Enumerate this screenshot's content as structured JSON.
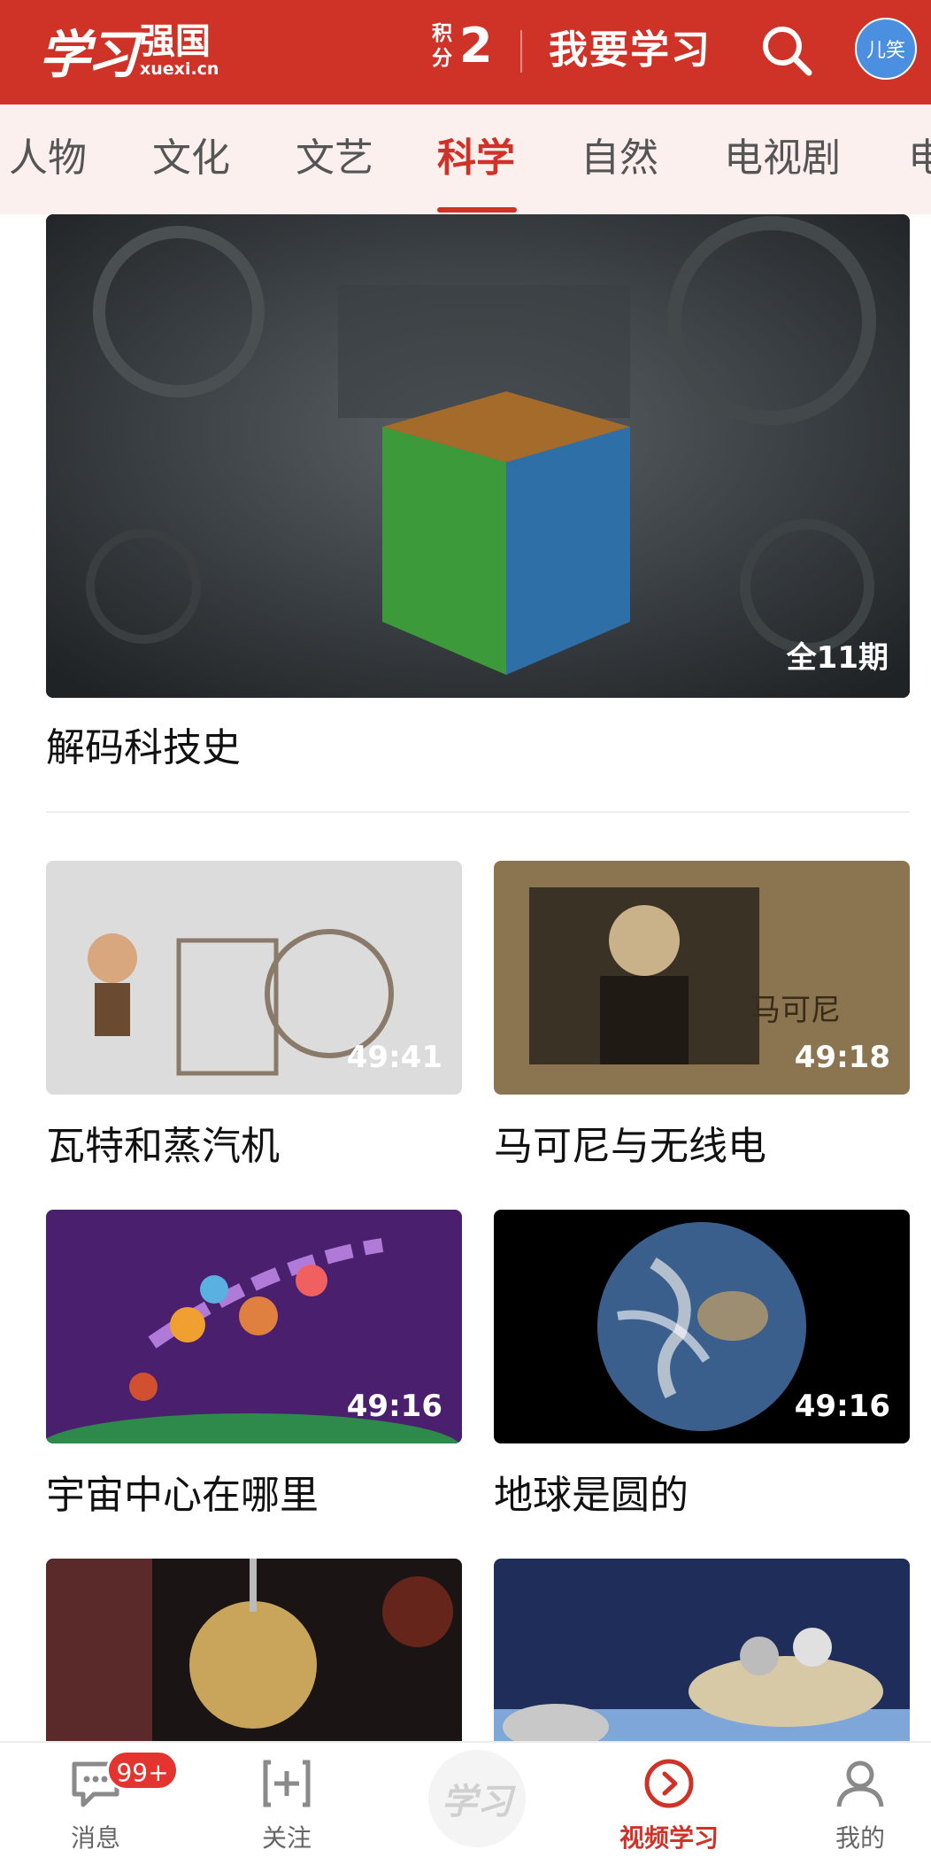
{
  "header": {
    "logo_script": "学习",
    "logo_title": "强国",
    "logo_url": "xuexi.cn",
    "points_label_top": "积",
    "points_label_bottom": "分",
    "points_value": "2",
    "study_label": "我要学习",
    "avatar_text": "儿笑",
    "accent_color": "#cf3226"
  },
  "tabs": [
    {
      "label": "人物"
    },
    {
      "label": "文化"
    },
    {
      "label": "文艺"
    },
    {
      "label": "科学",
      "active": true
    },
    {
      "label": "自然"
    },
    {
      "label": "电视剧"
    },
    {
      "label": "电"
    }
  ],
  "hero": {
    "title": "解码科技史",
    "badge": "全11期"
  },
  "videos": [
    {
      "title": "瓦特和蒸汽机",
      "duration": "49:41"
    },
    {
      "title": "马可尼与无线电",
      "duration": "49:18"
    },
    {
      "title": "宇宙中心在哪里",
      "duration": "49:16"
    },
    {
      "title": "地球是圆的",
      "duration": "49:16"
    },
    {
      "title": "",
      "duration": ""
    },
    {
      "title": "",
      "duration": ""
    }
  ],
  "bottom_nav": {
    "messages": {
      "label": "消息",
      "badge": "99+"
    },
    "follow": {
      "label": "关注"
    },
    "center": {
      "text": "学习"
    },
    "video_study": {
      "label": "视频学习"
    },
    "mine": {
      "label": "我的"
    }
  }
}
